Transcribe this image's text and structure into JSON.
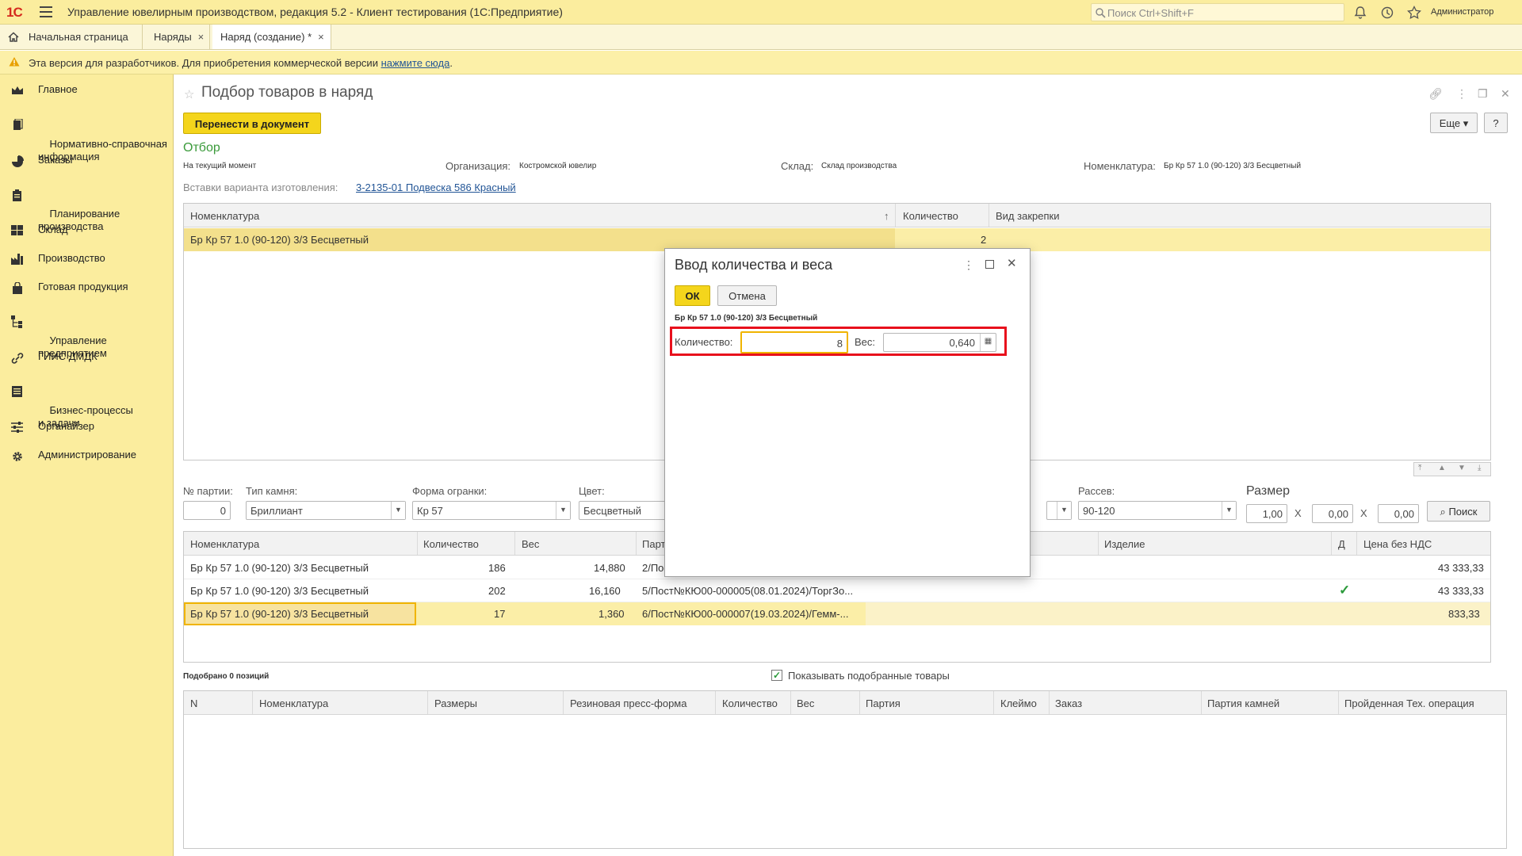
{
  "titlebar": {
    "logo": "1С",
    "title": "Управление ювелирным производством, редакция 5.2  - Клиент тестирования (1С:Предприятие)",
    "search_placeholder": "Поиск Ctrl+Shift+F",
    "user": "Администратор"
  },
  "tabs": [
    {
      "label": "Начальная страница"
    },
    {
      "label": "Наряды",
      "close": "×"
    },
    {
      "label": "Наряд (создание) *",
      "close": "×"
    }
  ],
  "banner": {
    "text": "Эта версия для разработчиков. Для приобретения коммерческой версии ",
    "link": "нажмите сюда",
    "end": "."
  },
  "sidebar": [
    {
      "label": "Главное",
      "icon": "crown-icon"
    },
    {
      "label": "Нормативно-справочная\nинформация",
      "icon": "book-icon"
    },
    {
      "label": "Заказы",
      "icon": "pie-icon"
    },
    {
      "label": "Планирование\nпроизводства",
      "icon": "clipboard-icon"
    },
    {
      "label": "Склад",
      "icon": "grid-icon"
    },
    {
      "label": "Производство",
      "icon": "factory-icon"
    },
    {
      "label": "Готовая продукция",
      "icon": "bag-icon"
    },
    {
      "label": "Управление\nпредприятием",
      "icon": "org-icon"
    },
    {
      "label": "ГИИС ДМДК",
      "icon": "link-icon"
    },
    {
      "label": "Бизнес-процессы\nи задачи",
      "icon": "list-icon"
    },
    {
      "label": "Органайзер",
      "icon": "sliders-icon"
    },
    {
      "label": "Администрирование",
      "icon": "gear-icon"
    }
  ],
  "form": {
    "title": "Подбор товаров в наряд",
    "move_button": "Перенести в документ",
    "more_button": "Еще",
    "help_button": "?",
    "section": "Отбор",
    "moment": "На текущий момент",
    "org_label": "Организация:",
    "org_value": "Костромской ювелир",
    "warehouse_label": "Склад:",
    "warehouse_value": "Склад производства",
    "nom_label": "Номенклатура:",
    "nom_value": "Бр Кр 57 1.0 (90-120) 3/3 Бесцветный",
    "variant_label": "Вставки варианта изготовления:",
    "variant_link": "3-2135-01 Подвеска 586 Красный"
  },
  "grid1": {
    "headers": [
      "Номенклатура",
      "Количество",
      "Вид закрепки"
    ],
    "sort": "↑",
    "rows": [
      [
        "Бр Кр 57 1.0 (90-120) 3/3 Бесцветный",
        "2",
        ""
      ]
    ]
  },
  "filters": {
    "batch_label": "№ партии:",
    "batch_value": "0",
    "stone_label": "Тип камня:",
    "stone_value": "Бриллиант",
    "cut_label": "Форма огранки:",
    "cut_value": "Кр 57",
    "color_label": "Цвет:",
    "color_value": "Бесцветный",
    "sieve_label": "Рассев:",
    "sieve_value": "90-120",
    "size_label": "Размер",
    "size1": "1,00",
    "size2": "0,00",
    "size3": "0,00",
    "x": "Х",
    "search_button": "Поиск"
  },
  "grid2": {
    "headers": [
      "Номенклатура",
      "Количество",
      "Вес",
      "Парт",
      "Изделие",
      "Д",
      "Цена без НДС"
    ],
    "rows": [
      {
        "nom": "Бр Кр 57 1.0 (90-120) 3/3 Бесцветный",
        "qty": "186",
        "weight": "14,880",
        "batch": "2/Пос",
        "check": "",
        "price": "43 333,33"
      },
      {
        "nom": "Бр Кр 57 1.0 (90-120) 3/3 Бесцветный",
        "qty": "202",
        "weight": "16,160",
        "batch": "5/Пост№КЮ00-000005(08.01.2024)/ТоргЗо...",
        "check": "✓",
        "price": "43 333,33"
      },
      {
        "nom": "Бр Кр 57 1.0 (90-120) 3/3 Бесцветный",
        "qty": "17",
        "weight": "1,360",
        "batch": "6/Пост№КЮ00-000007(19.03.2024)/Гемм-...",
        "check": "",
        "price": "833,33"
      }
    ]
  },
  "picked": {
    "count": "Подобрано 0 позиций",
    "show_label": "Показывать подобранные товары"
  },
  "grid3": {
    "headers": [
      "N",
      "Номенклатура",
      "Размеры",
      "Резиновая пресс-форма",
      "Количество",
      "Вес",
      "Партия",
      "Клеймо",
      "Заказ",
      "Партия камней",
      "Пройденная Тех. операция"
    ]
  },
  "modal": {
    "title": "Ввод количества и веса",
    "ok": "ОК",
    "cancel": "Отмена",
    "item": "Бр Кр 57 1.0 (90-120) 3/3 Бесцветный",
    "qty_label": "Количество:",
    "qty_value": "8",
    "weight_label": "Вес:",
    "weight_value": "0,640"
  },
  "colors": {
    "accent": "#f4d51c",
    "sidebar": "#fbed9e",
    "selection": "#fbeea7",
    "highlight": "#e8101c",
    "check": "#2a9a3a"
  }
}
